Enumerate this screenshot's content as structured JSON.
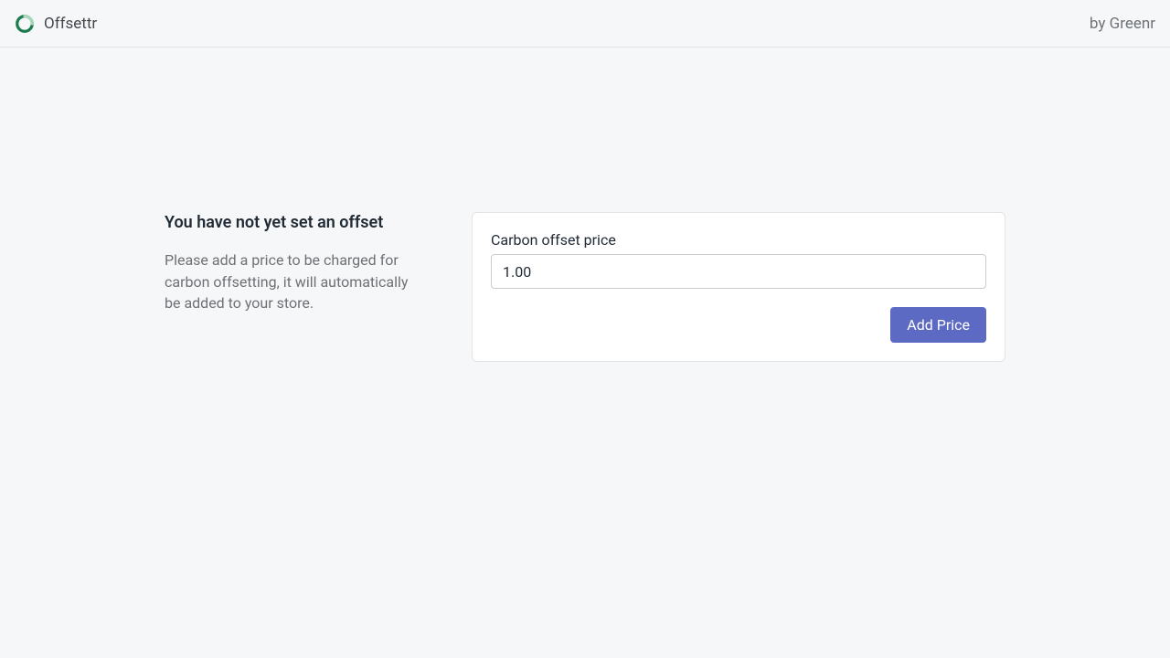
{
  "header": {
    "brand": "Offsettr",
    "byline": "by Greenr"
  },
  "main": {
    "heading": "You have not yet set an offset",
    "description": "Please add a price to be charged for carbon offsetting, it will automatically be added to your store."
  },
  "form": {
    "price_label": "Carbon offset price",
    "price_value": "1.00",
    "submit_label": "Add Price"
  }
}
